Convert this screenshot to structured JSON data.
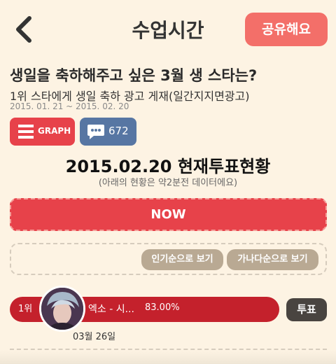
{
  "header": {
    "title": "수업시간",
    "share_label": "공유해요"
  },
  "poll": {
    "question": "생일을 축하해주고 싶은 3월 생 스타는?",
    "subtitle": "1위 스타에게 생일 축하 광고 게재(일간지지면광고)",
    "period": "2015. 01. 21 ~ 2015. 02. 20",
    "graph_label": "GRAPH",
    "comment_count": "672"
  },
  "status": {
    "title": "2015.02.20 현재투표현황",
    "note": "(아래의 현황은 약2분전 데이터에요)"
  },
  "now_label": "NOW",
  "sort": {
    "popular_label": "인기순으로 보기",
    "alpha_label": "가나다순으로 보기"
  },
  "ranking": [
    {
      "rank": "1위",
      "name": "엑소 - 시...",
      "percent": "83.00%",
      "birthday": "03월 26일",
      "vote_label": "투표"
    }
  ],
  "colors": {
    "background": "#fdf3e3",
    "accent_red": "#e7424a",
    "share_coral": "#f36f69",
    "comment_blue": "#5776a3",
    "bar_red": "#c4212c",
    "sort_tan": "#b9a993",
    "vote_dark": "#494440"
  },
  "icons": {
    "back": "chevron-left-icon",
    "graph": "bar-list-icon",
    "comment": "speech-bubble-icon"
  }
}
